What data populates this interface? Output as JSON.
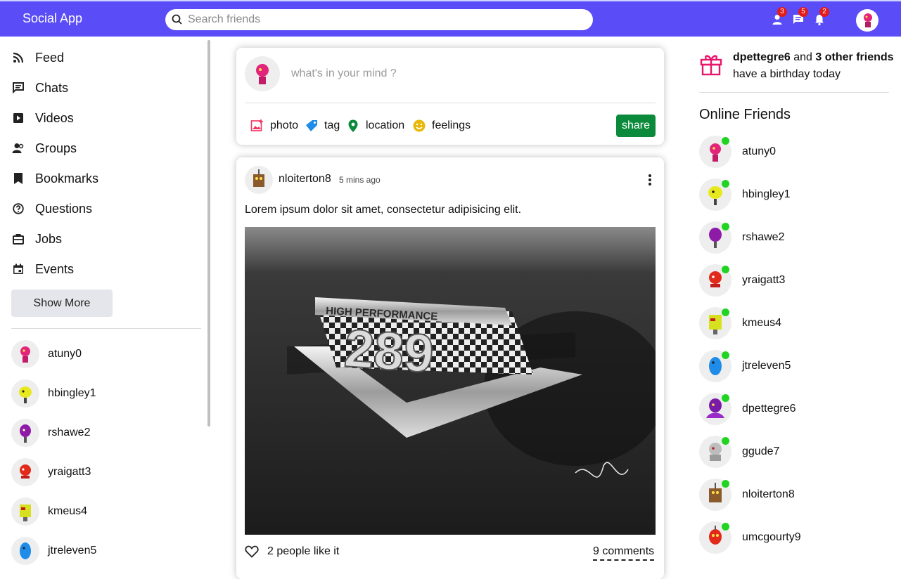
{
  "app": {
    "brand": "Social App"
  },
  "search": {
    "placeholder": "Search friends"
  },
  "notifications": {
    "friend_requests": "3",
    "messages": "5",
    "alerts": "2"
  },
  "sidebar": {
    "menu": [
      {
        "label": "Feed",
        "icon": "rss-icon"
      },
      {
        "label": "Chats",
        "icon": "chat-icon"
      },
      {
        "label": "Videos",
        "icon": "play-icon"
      },
      {
        "label": "Groups",
        "icon": "group-icon"
      },
      {
        "label": "Bookmarks",
        "icon": "bookmark-icon"
      },
      {
        "label": "Questions",
        "icon": "help-icon"
      },
      {
        "label": "Jobs",
        "icon": "work-icon"
      },
      {
        "label": "Events",
        "icon": "event-icon"
      }
    ],
    "show_more": "Show More",
    "friends": [
      {
        "name": "atuny0"
      },
      {
        "name": "hbingley1"
      },
      {
        "name": "rshawe2"
      },
      {
        "name": "yraigatt3"
      },
      {
        "name": "kmeus4"
      },
      {
        "name": "jtreleven5"
      }
    ]
  },
  "share": {
    "placeholder": "what's in your mind ?",
    "options": [
      {
        "label": "photo",
        "icon": "photo-icon",
        "color": "#f2335f"
      },
      {
        "label": "tag",
        "icon": "tag-icon",
        "color": "#1e8ce8"
      },
      {
        "label": "location",
        "icon": "location-icon",
        "color": "#0c8a3b"
      },
      {
        "label": "feelings",
        "icon": "emoji-icon",
        "color": "#e8b90c"
      }
    ],
    "button": "share"
  },
  "post": {
    "username": "nloiterton8",
    "time": "5 mins ago",
    "text": "Lorem ipsum dolor sit amet, consectetur adipisicing elit.",
    "image_text": "HIGH PERFORMANCE",
    "image_number": "289",
    "likes": "2 people like it",
    "comments": "9 comments"
  },
  "birthday": {
    "user": "dpettegre6",
    "middle": "and",
    "others": "3 other friends",
    "rest": "have a birthday today"
  },
  "online": {
    "title": "Online Friends",
    "friends": [
      {
        "name": "atuny0"
      },
      {
        "name": "hbingley1"
      },
      {
        "name": "rshawe2"
      },
      {
        "name": "yraigatt3"
      },
      {
        "name": "kmeus4"
      },
      {
        "name": "jtreleven5"
      },
      {
        "name": "dpettegre6"
      },
      {
        "name": "ggude7"
      },
      {
        "name": "nloiterton8"
      },
      {
        "name": "umcgourty9"
      }
    ]
  },
  "colors": {
    "topbar": "#5a4cf7",
    "share_button": "#0c8a3b",
    "online_dot": "#22d422",
    "badge": "#e21b1b",
    "gift": "#e8166b"
  }
}
